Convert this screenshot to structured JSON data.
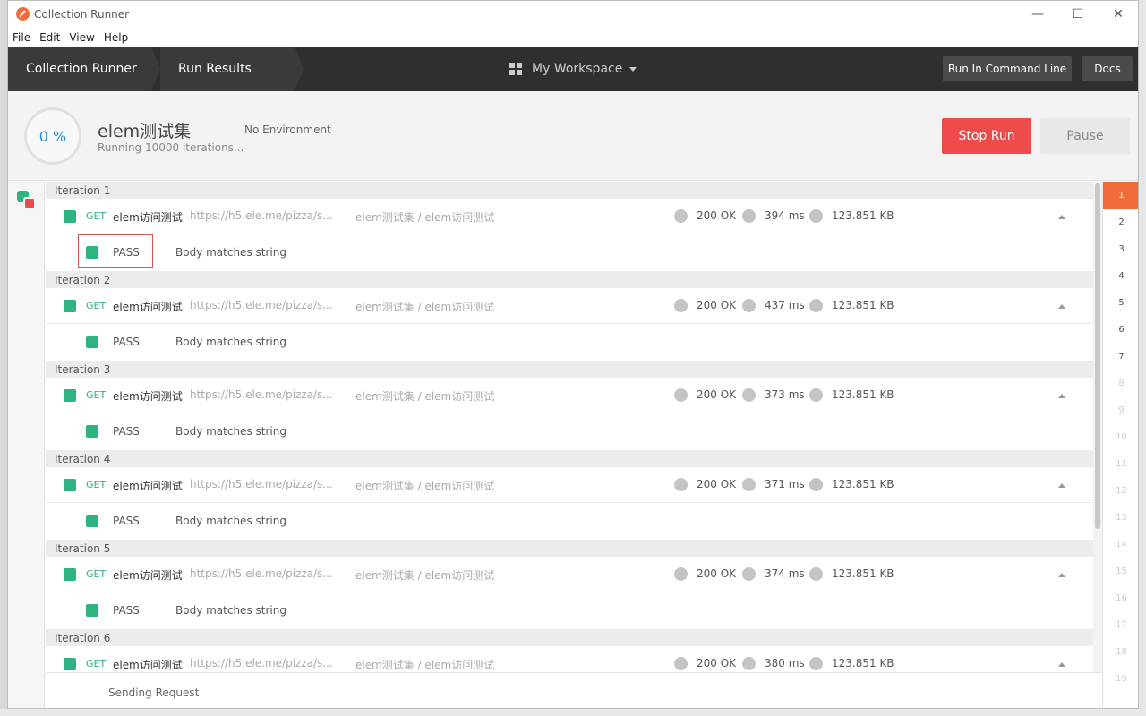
{
  "window": {
    "title": "Collection Runner"
  },
  "menu": [
    "File",
    "Edit",
    "View",
    "Help"
  ],
  "header": {
    "crumb1": "Collection Runner",
    "crumb2": "Run Results",
    "workspace": "My Workspace",
    "run_cli": "Run In Command Line",
    "docs": "Docs"
  },
  "summary": {
    "progress": "0 %",
    "collection": "elem测试集",
    "status": "Running 10000 iterations...",
    "environment": "No Environment",
    "stop": "Stop Run",
    "pause": "Pause"
  },
  "iterations": [
    {
      "label": "Iteration 1",
      "method": "GET",
      "name": "elem访问测试",
      "url": "https://h5.ele.me/pizza/s...",
      "path": "elem测试集 / elem访问测试",
      "status": "200 OK",
      "time": "394 ms",
      "size": "123.851 KB",
      "result": "PASS",
      "test": "Body matches string"
    },
    {
      "label": "Iteration 2",
      "method": "GET",
      "name": "elem访问测试",
      "url": "https://h5.ele.me/pizza/s...",
      "path": "elem测试集 / elem访问测试",
      "status": "200 OK",
      "time": "437 ms",
      "size": "123.851 KB",
      "result": "PASS",
      "test": "Body matches string"
    },
    {
      "label": "Iteration 3",
      "method": "GET",
      "name": "elem访问测试",
      "url": "https://h5.ele.me/pizza/s...",
      "path": "elem测试集 / elem访问测试",
      "status": "200 OK",
      "time": "373 ms",
      "size": "123.851 KB",
      "result": "PASS",
      "test": "Body matches string"
    },
    {
      "label": "Iteration 4",
      "method": "GET",
      "name": "elem访问测试",
      "url": "https://h5.ele.me/pizza/s...",
      "path": "elem测试集 / elem访问测试",
      "status": "200 OK",
      "time": "371 ms",
      "size": "123.851 KB",
      "result": "PASS",
      "test": "Body matches string"
    },
    {
      "label": "Iteration 5",
      "method": "GET",
      "name": "elem访问测试",
      "url": "https://h5.ele.me/pizza/s...",
      "path": "elem测试集 / elem访问测试",
      "status": "200 OK",
      "time": "374 ms",
      "size": "123.851 KB",
      "result": "PASS",
      "test": "Body matches string"
    },
    {
      "label": "Iteration 6",
      "method": "GET",
      "name": "elem访问测试",
      "url": "https://h5.ele.me/pizza/s...",
      "path": "elem测试集 / elem访问测试",
      "status": "200 OK",
      "time": "380 ms",
      "size": "123.851 KB"
    }
  ],
  "iteration_nav": [
    "1",
    "2",
    "3",
    "4",
    "5",
    "6",
    "7",
    "8",
    "9",
    "10",
    "11",
    "12",
    "13",
    "14",
    "15",
    "16",
    "17",
    "18",
    "19"
  ],
  "footer": {
    "status": "Sending Request"
  },
  "colors": {
    "accent": "#f26b3a",
    "pass": "#2fb380",
    "stop": "#ef4b4b",
    "header": "#2f2f2f"
  }
}
